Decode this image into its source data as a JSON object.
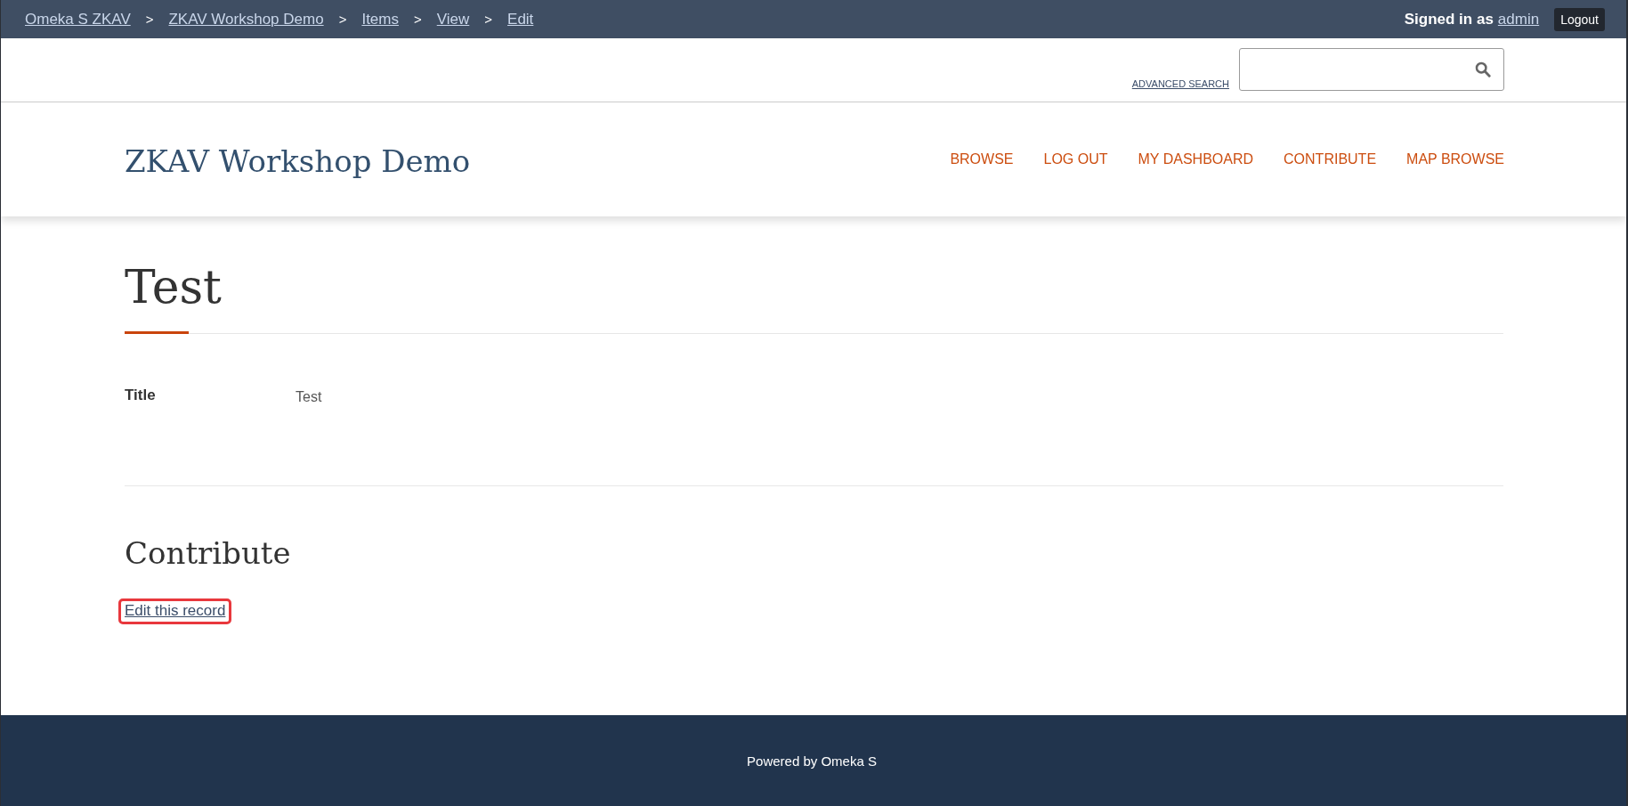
{
  "admin_bar": {
    "breadcrumbs": [
      {
        "label": "Omeka S ZKAV"
      },
      {
        "separator": ">",
        "label": "ZKAV Workshop Demo"
      },
      {
        "separator": ">",
        "label": "Items"
      },
      {
        "separator": ">",
        "label": "View"
      },
      {
        "separator": ">",
        "label": "Edit"
      }
    ],
    "signed_in": {
      "text": "Signed in as",
      "user": "admin"
    },
    "logout_button": "Logout"
  },
  "search": {
    "advanced_search_link": "ADVANCED SEARCH"
  },
  "site": {
    "title": "ZKAV Workshop Demo",
    "nav": [
      {
        "label": "BROWSE"
      },
      {
        "label": "LOG OUT"
      },
      {
        "label": "MY DASHBOARD"
      },
      {
        "label": "CONTRIBUTE"
      },
      {
        "label": "MAP BROWSE"
      }
    ]
  },
  "item": {
    "title": "Test",
    "properties": [
      {
        "label": "Title",
        "value": "Test"
      }
    ]
  },
  "contribute": {
    "heading": "Contribute",
    "link": {
      "label": "Edit this record",
      "highlighted": true
    }
  },
  "footer": {
    "text": "Powered by Omeka S"
  }
}
